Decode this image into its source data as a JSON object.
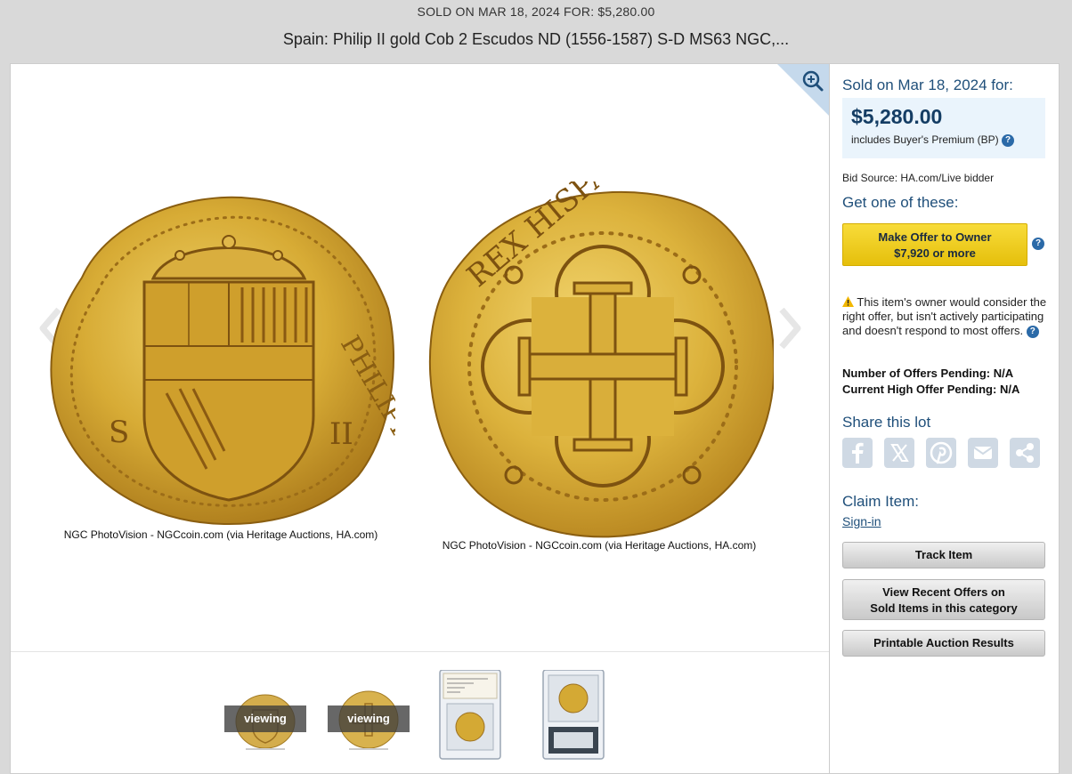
{
  "header": {
    "sold_line": "SOLD ON MAR 18, 2024 FOR: $5,280.00",
    "title": "Spain: Philip II gold Cob 2 Escudos ND (1556-1587) S-D MS63 NGC,..."
  },
  "gallery": {
    "captions": [
      "NGC PhotoVision - NGCcoin.com (via Heritage Auctions, HA.com)",
      "NGC PhotoVision - NGCcoin.com (via Heritage Auctions, HA.com)"
    ],
    "coin_obverse_legend": "PHILIPPVS",
    "coin_reverse_legend": "REX HISPANIARVM",
    "thumbnails": [
      {
        "label": "viewing",
        "kind": "coin-obverse"
      },
      {
        "label": "viewing",
        "kind": "coin-reverse"
      },
      {
        "label": "",
        "kind": "slab-front"
      },
      {
        "label": "",
        "kind": "slab-back"
      }
    ]
  },
  "sidebar": {
    "sold_on": "Sold on Mar 18, 2024 for:",
    "price": "$5,280.00",
    "bp_note": "includes Buyer's Premium (BP)",
    "help_symbol": "?",
    "bid_source": "Bid Source: HA.com/Live bidder",
    "get_one": "Get one of these:",
    "offer_button_line1": "Make Offer to Owner",
    "offer_button_line2": "$7,920 or more",
    "notice": "This item's owner would consider the right offer, but isn't actively participating and doesn't respond to most offers.",
    "offers_pending": "Number of Offers Pending: N/A",
    "high_offer": "Current High Offer Pending: N/A",
    "share_title": "Share this lot",
    "share_icons": [
      "facebook-icon",
      "x-icon",
      "pinterest-icon",
      "email-icon",
      "share-icon"
    ],
    "claim_title": "Claim Item:",
    "sign_in": "Sign-in",
    "track_button": "Track Item",
    "recent_offers_line1": "View Recent Offers on",
    "recent_offers_line2": "Sold Items in this category",
    "printable_button": "Printable Auction Results"
  },
  "colors": {
    "accent_blue": "#1f4f7a",
    "price_box_bg": "#eaf4fc",
    "offer_yellow": "#f2cf1e",
    "coin_gold": "#d4a934"
  }
}
